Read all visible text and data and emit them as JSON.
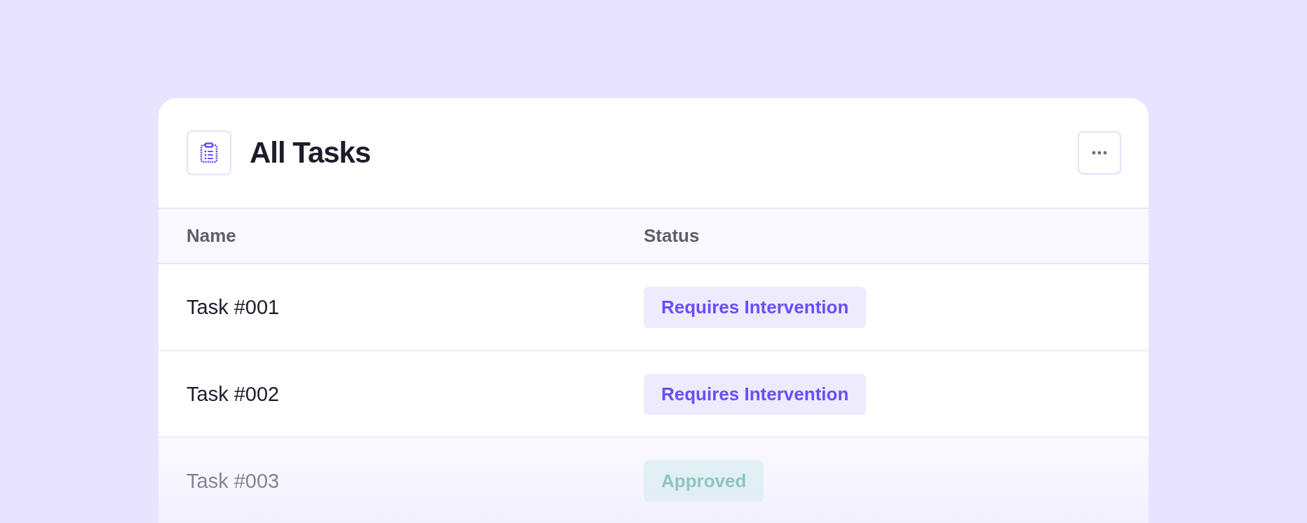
{
  "card": {
    "title": "All Tasks"
  },
  "table": {
    "columns": [
      "Name",
      "Status"
    ],
    "rows": [
      {
        "name": "Task #001",
        "status": {
          "label": "Requires Intervention",
          "kind": "attention"
        }
      },
      {
        "name": "Task #002",
        "status": {
          "label": "Requires Intervention",
          "kind": "attention"
        }
      },
      {
        "name": "Task #003",
        "status": {
          "label": "Approved",
          "kind": "approved"
        }
      }
    ]
  }
}
